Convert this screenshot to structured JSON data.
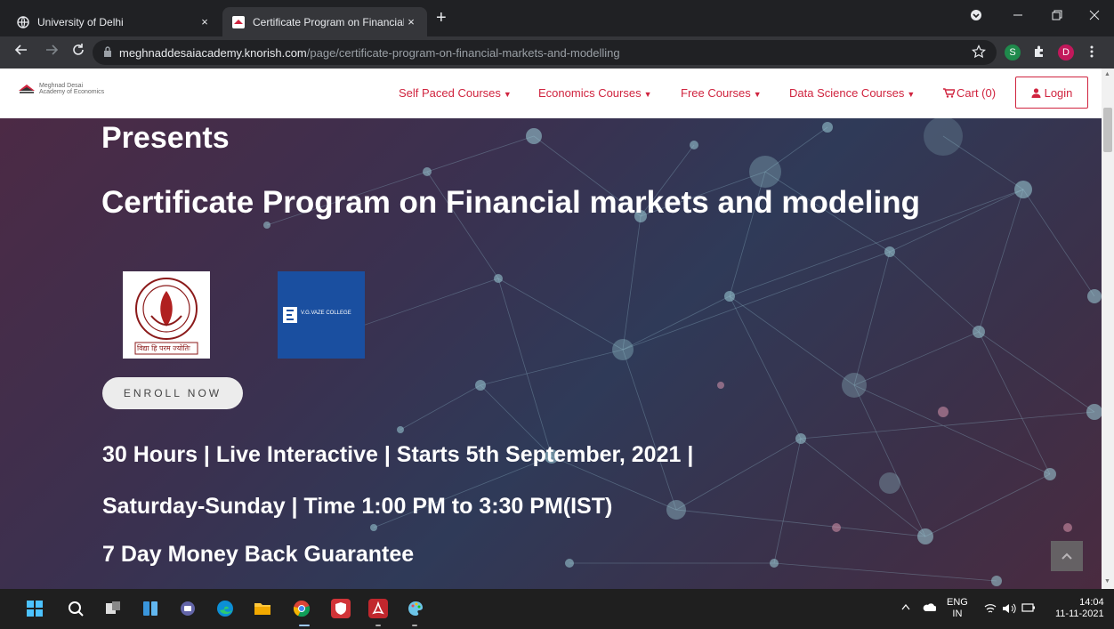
{
  "browser": {
    "tabs": [
      {
        "title": "University of Delhi",
        "active": false
      },
      {
        "title": "Certificate Program on Financial",
        "active": true
      }
    ],
    "close_glyph": "×",
    "new_tab_glyph": "+",
    "url_domain": "meghnaddesaiacademy.knorish.com",
    "url_path": "/page/certificate-program-on-financial-markets-and-modelling",
    "profile_initial": "D"
  },
  "site": {
    "brand_line1": "Meghnad Desai",
    "brand_line2": "Academy of Economics",
    "nav": [
      {
        "label": "Self Paced Courses"
      },
      {
        "label": "Economics Courses"
      },
      {
        "label": "Free Courses"
      },
      {
        "label": "Data Science Courses"
      }
    ],
    "cart_label": "Cart (0)",
    "login_label": "Login",
    "accent": "#d0243f"
  },
  "hero": {
    "presents": "Presents",
    "program_title": "Certificate Program on Financial markets and modeling",
    "logo1_text": "विद्या हि परम ज्योतिः",
    "logo2_text": "V.G.VAZE COLLEGE",
    "enroll_label": "ENROLL NOW",
    "line1": "30 Hours | Live Interactive | Starts 5th September, 2021 |",
    "line2": "Saturday-Sunday | Time 1:00 PM to 3:30 PM(IST)",
    "line3": "7 Day Money Back Guarantee"
  },
  "taskbar": {
    "lang_line1": "ENG",
    "lang_line2": "IN",
    "time": "14:04",
    "date": "11-11-2021"
  }
}
